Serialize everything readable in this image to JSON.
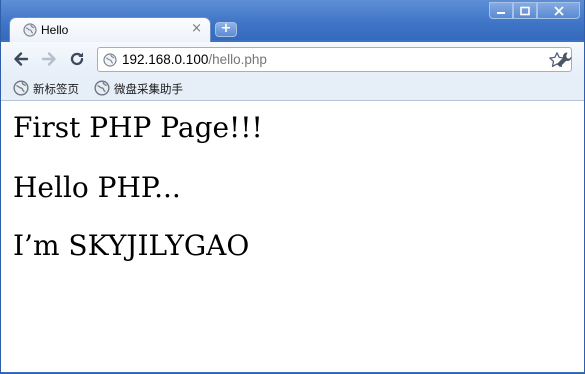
{
  "tab": {
    "title": "Hello",
    "close_glyph": "×"
  },
  "window_controls": {
    "min_icon": "minimize-icon",
    "max_icon": "maximize-icon",
    "close_icon": "close-icon"
  },
  "toolbar": {
    "back_icon": "back-arrow-icon",
    "forward_icon": "forward-arrow-icon",
    "reload_icon": "reload-icon",
    "url_host": "192.168.0.100",
    "url_path": "/hello.php",
    "star_icon": "star-icon",
    "wrench_icon": "wrench-icon"
  },
  "bookmarks": [
    {
      "label": "新标签页",
      "icon": "globe-icon"
    },
    {
      "label": "微盘采集助手",
      "icon": "globe-icon"
    }
  ],
  "content": {
    "lines": [
      "First PHP Page!!!",
      "Hello PHP...",
      "I’m SKYJILYGAO"
    ]
  },
  "colors": {
    "frame": "#3b72c4",
    "toolbar": "#e6eef8",
    "accent": "#4a7cc8"
  }
}
